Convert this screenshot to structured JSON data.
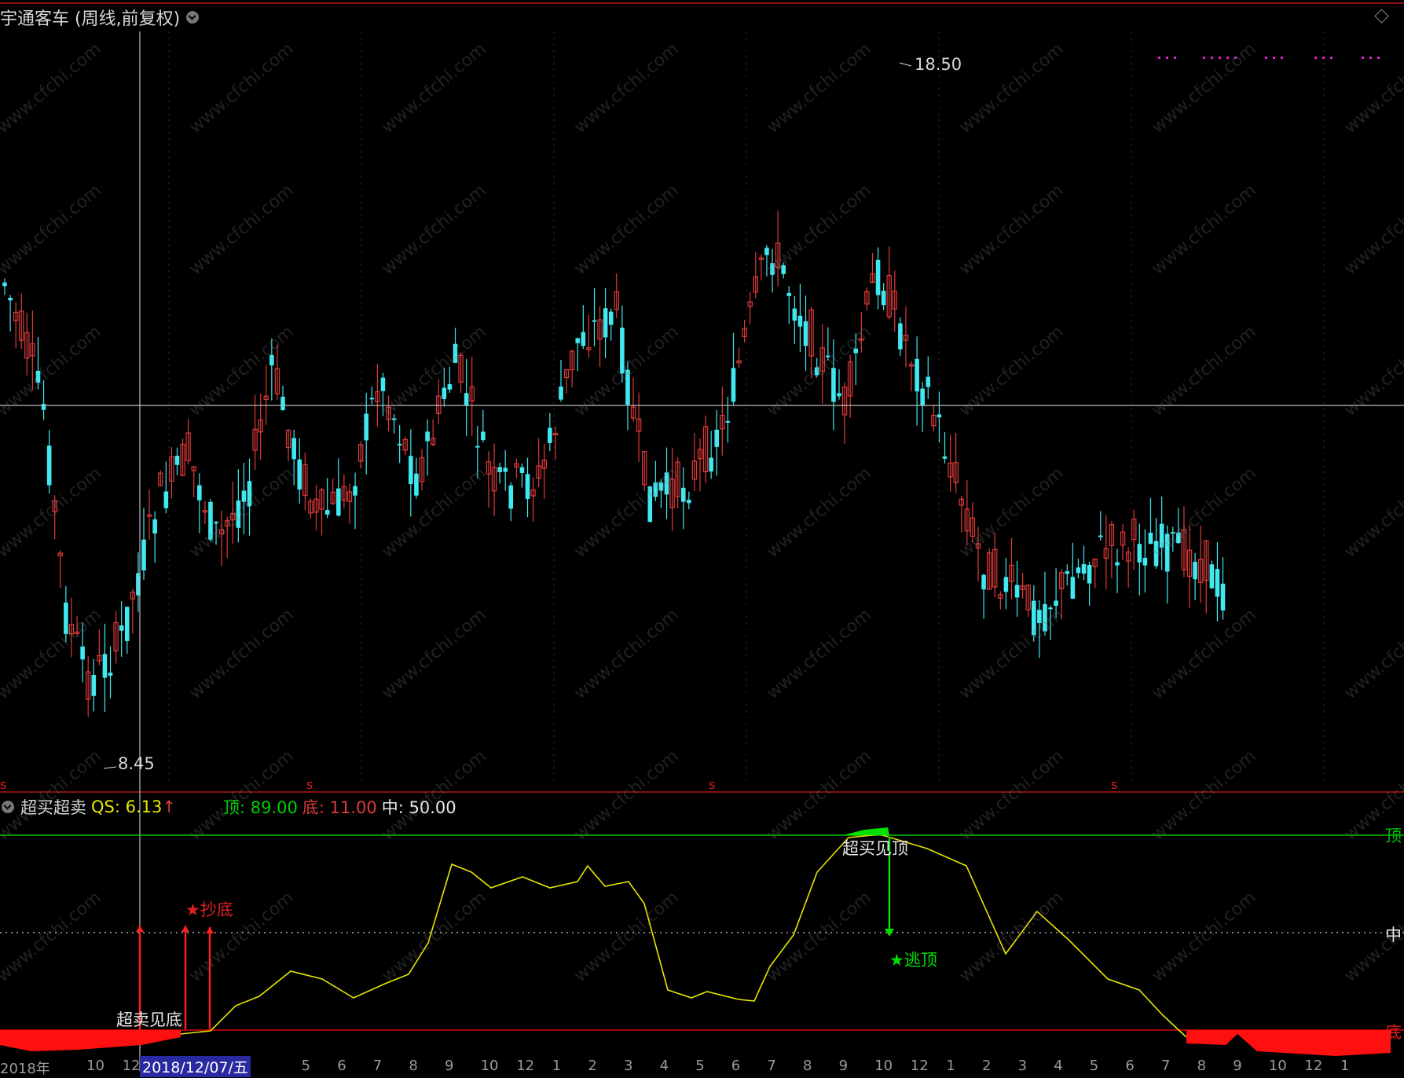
{
  "header": {
    "stock_title": "宇通客车 (周线,前复权)"
  },
  "price_labels": {
    "high": "18.50",
    "low": "8.45"
  },
  "indicator": {
    "name": "超买超卖",
    "qs_label": "QS: 6.13",
    "qs_arrow": "↑",
    "top_label": "顶: 89.00",
    "bottom_label": "底: 11.00",
    "mid_label": "中: 50.00"
  },
  "signals": {
    "oversold": "超卖见底",
    "buy_bottom": "★抄底",
    "overbought": "超买见顶",
    "escape_top": "★逃顶"
  },
  "right_labels": {
    "top": "顶",
    "mid": "中",
    "bottom": "底"
  },
  "axis": {
    "year_label": "2018年",
    "cursor_date": "2018/12/07/五",
    "ticks": [
      "10",
      "12",
      "1",
      "2",
      "3",
      "4",
      "5",
      "6",
      "7",
      "8",
      "9",
      "10",
      "12",
      "1",
      "2",
      "3",
      "4",
      "5",
      "6",
      "7",
      "8",
      "9",
      "10",
      "12",
      "1",
      "2",
      "3",
      "4",
      "5",
      "6",
      "7",
      "8",
      "9",
      "10",
      "12",
      "1"
    ]
  },
  "watermark": "www.cfchi.com",
  "colors": {
    "up": "#e03a3a",
    "down": "#40e8f0",
    "indicator_line": "#e6e600",
    "top_line": "#00c800",
    "bottom_line": "#e00000"
  }
}
